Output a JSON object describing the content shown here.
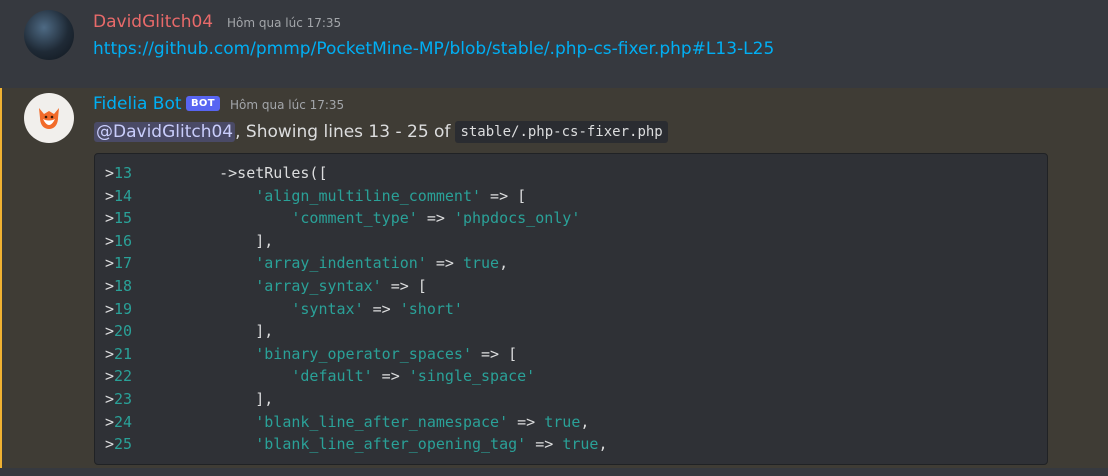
{
  "messages": [
    {
      "author": "DavidGlitch04",
      "timestamp": "Hôm qua lúc 17:35",
      "link": "https://github.com/pmmp/PocketMine-MP/blob/stable/.php-cs-fixer.php#L13-L25"
    },
    {
      "author": "Fidelia Bot",
      "bot_tag": "BOT",
      "timestamp": "Hôm qua lúc 17:35",
      "mention": "@DavidGlitch04",
      "text_after_mention": ", Showing lines 13 - 25 of",
      "file_code": "stable/.php-cs-fixer.php",
      "code_lines": [
        {
          "num": "13",
          "prefix": ">",
          "indent": "    ",
          "parts": [
            {
              "t": "p",
              "v": "->setRules(["
            }
          ]
        },
        {
          "num": "14",
          "prefix": ">",
          "indent": "        ",
          "parts": [
            {
              "t": "s",
              "v": "'align_multiline_comment'"
            },
            {
              "t": "p",
              "v": " => ["
            }
          ]
        },
        {
          "num": "15",
          "prefix": ">",
          "indent": "            ",
          "parts": [
            {
              "t": "s",
              "v": "'comment_type'"
            },
            {
              "t": "p",
              "v": " => "
            },
            {
              "t": "s",
              "v": "'phpdocs_only'"
            }
          ]
        },
        {
          "num": "16",
          "prefix": ">",
          "indent": "        ",
          "parts": [
            {
              "t": "p",
              "v": "],"
            }
          ]
        },
        {
          "num": "17",
          "prefix": ">",
          "indent": "        ",
          "parts": [
            {
              "t": "s",
              "v": "'array_indentation'"
            },
            {
              "t": "p",
              "v": " => "
            },
            {
              "t": "k",
              "v": "true"
            },
            {
              "t": "p",
              "v": ","
            }
          ]
        },
        {
          "num": "18",
          "prefix": ">",
          "indent": "        ",
          "parts": [
            {
              "t": "s",
              "v": "'array_syntax'"
            },
            {
              "t": "p",
              "v": " => ["
            }
          ]
        },
        {
          "num": "19",
          "prefix": ">",
          "indent": "            ",
          "parts": [
            {
              "t": "s",
              "v": "'syntax'"
            },
            {
              "t": "p",
              "v": " => "
            },
            {
              "t": "s",
              "v": "'short'"
            }
          ]
        },
        {
          "num": "20",
          "prefix": ">",
          "indent": "        ",
          "parts": [
            {
              "t": "p",
              "v": "],"
            }
          ]
        },
        {
          "num": "21",
          "prefix": ">",
          "indent": "        ",
          "parts": [
            {
              "t": "s",
              "v": "'binary_operator_spaces'"
            },
            {
              "t": "p",
              "v": " => ["
            }
          ]
        },
        {
          "num": "22",
          "prefix": ">",
          "indent": "            ",
          "parts": [
            {
              "t": "s",
              "v": "'default'"
            },
            {
              "t": "p",
              "v": " => "
            },
            {
              "t": "s",
              "v": "'single_space'"
            }
          ]
        },
        {
          "num": "23",
          "prefix": ">",
          "indent": "        ",
          "parts": [
            {
              "t": "p",
              "v": "],"
            }
          ]
        },
        {
          "num": "24",
          "prefix": ">",
          "indent": "        ",
          "parts": [
            {
              "t": "s",
              "v": "'blank_line_after_namespace'"
            },
            {
              "t": "p",
              "v": " => "
            },
            {
              "t": "k",
              "v": "true"
            },
            {
              "t": "p",
              "v": ","
            }
          ]
        },
        {
          "num": "25",
          "prefix": ">",
          "indent": "        ",
          "parts": [
            {
              "t": "s",
              "v": "'blank_line_after_opening_tag'"
            },
            {
              "t": "p",
              "v": " => "
            },
            {
              "t": "k",
              "v": "true"
            },
            {
              "t": "p",
              "v": ","
            }
          ]
        }
      ]
    }
  ],
  "colors": {
    "background": "#36393f",
    "highlight_background": "#3f3c35",
    "highlight_border": "#f0b232",
    "author1": "#e86a6a",
    "author2": "#00aff4",
    "link": "#00aff4",
    "code_token": "#2aa198",
    "bot_tag": "#5865f2"
  }
}
